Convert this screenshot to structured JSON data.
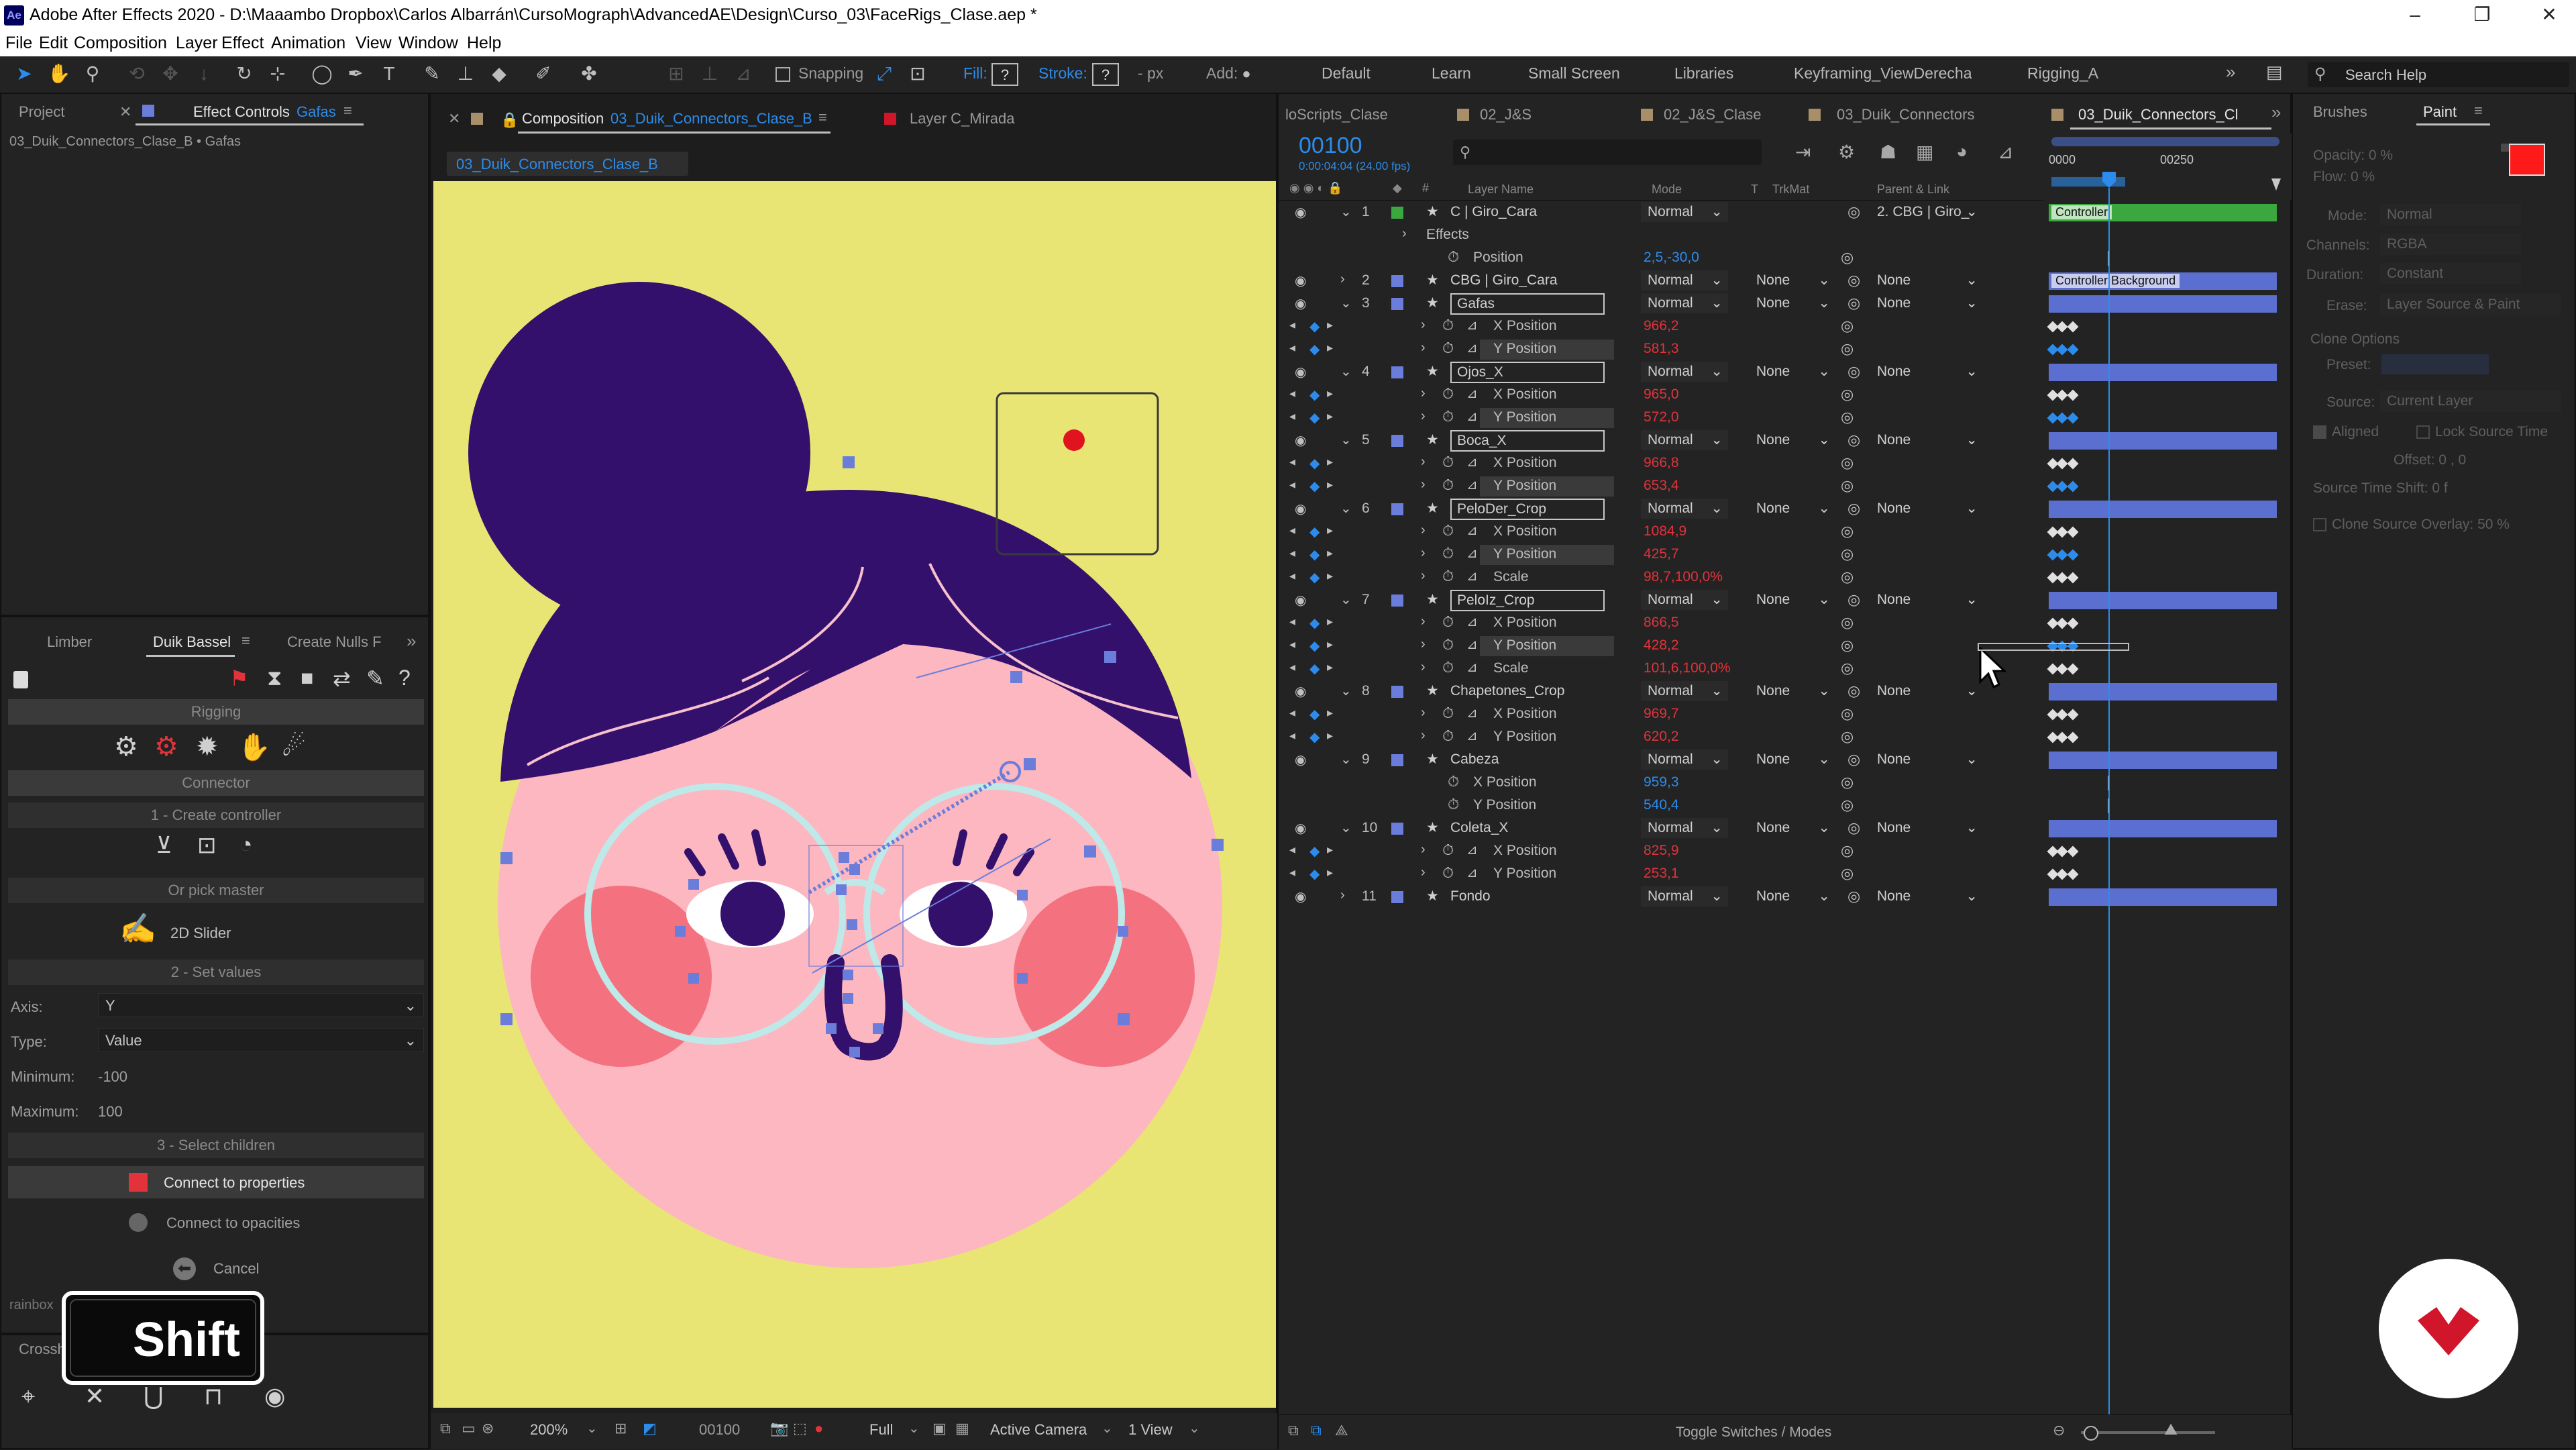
{
  "app": {
    "title": "Adobe After Effects 2020 - D:\\Maaambo Dropbox\\Carlos Albarrán\\CursoMograph\\AdvancedAE\\Design\\Curso_03\\FaceRigs_Clase.aep *",
    "logo": "Ae"
  },
  "menu": [
    "File",
    "Edit",
    "Composition",
    "Layer",
    "Effect",
    "Animation",
    "View",
    "Window",
    "Help"
  ],
  "toolbar": {
    "snapping": "Snapping",
    "fill": "Fill:",
    "fill_value": "?",
    "stroke": "Stroke:",
    "stroke_value": "?",
    "px": "- px",
    "add": "Add:",
    "workspaces": [
      "Default",
      "Learn",
      "Small Screen",
      "Libraries",
      "Keyframing_ViewDerecha",
      "Rigging_A"
    ],
    "search_placeholder": "Search Help"
  },
  "left_panel": {
    "tabs": [
      "Project",
      "Effect Controls",
      "Gafas"
    ],
    "breadcrumb": "03_Duik_Connectors_Clase_B • Gafas"
  },
  "duik": {
    "tabs": [
      "Limber",
      "Duik Bassel",
      "Create Nulls F"
    ],
    "rigging": "Rigging",
    "connector": "Connector",
    "create_controller": "1 - Create controller",
    "or_pick_master": "Or pick master",
    "slider_label": "2D Slider",
    "set_values": "2 - Set values",
    "axis_label": "Axis:",
    "axis_value": "Y",
    "type_label": "Type:",
    "type_value": "Value",
    "min_label": "Minimum:",
    "min_value": "-100",
    "max_label": "Maximum:",
    "max_value": "100",
    "select_children": "3 - Select children",
    "connect_properties": "Connect to properties",
    "connect_opacities": "Connect to opacities",
    "cancel": "Cancel",
    "footer_text": "rainbox",
    "crosshair_tab": "Crossh",
    "shift_key": "Shift"
  },
  "composition": {
    "tab_prefix": "Composition",
    "tab_name": "03_Duik_Connectors_Clase_B",
    "layer_tab": "Layer C_Mirada",
    "breadcrumb": "03_Duik_Connectors_Clase_B",
    "zoom": "200%",
    "timecode": "00100",
    "resolution": "Full",
    "camera": "Active Camera",
    "view": "1 View"
  },
  "timeline": {
    "tabs": [
      "loScripts_Clase",
      "02_J&S",
      "02_J&S_Clase",
      "03_Duik_Connectors",
      "03_Duik_Connectors_Cl"
    ],
    "timecode": "00100",
    "timecode_sub": "0:00:04:04 (24.00 fps)",
    "columns": {
      "layer_name": "Layer Name",
      "mode": "Mode",
      "t": "T",
      "trkmat": "TrkMat",
      "parent": "Parent & Link"
    },
    "ruler": [
      "0000",
      "00250"
    ],
    "bar_labels": {
      "controller": "Controller",
      "controller_bg": "Controller Background"
    },
    "footer": "Toggle Switches / Modes",
    "rows": [
      {
        "type": "layer",
        "num": "1",
        "name": "C | Giro_Cara",
        "mode": "Normal",
        "trk": "",
        "parent": "2. CBG | Giro_",
        "green": true,
        "expanded": true
      },
      {
        "type": "group",
        "name": "Effects"
      },
      {
        "type": "prop",
        "name": "Position",
        "value": "2,5,-30,0",
        "blue": true,
        "static": true
      },
      {
        "type": "layer",
        "num": "2",
        "name": "CBG | Giro_Cara",
        "mode": "Normal",
        "trk": "None",
        "parent": "None"
      },
      {
        "type": "layer",
        "num": "3",
        "name": "Gafas",
        "mode": "Normal",
        "trk": "None",
        "parent": "None",
        "boxed": true,
        "expanded": true
      },
      {
        "type": "prop",
        "name": "X Position",
        "value": "966,2",
        "kf": true
      },
      {
        "type": "prop",
        "name": "Y Position",
        "value": "581,3",
        "kf": true,
        "hl": true
      },
      {
        "type": "layer",
        "num": "4",
        "name": "Ojos_X",
        "mode": "Normal",
        "trk": "None",
        "parent": "None",
        "boxed": true,
        "expanded": true
      },
      {
        "type": "prop",
        "name": "X Position",
        "value": "965,0",
        "kf": true
      },
      {
        "type": "prop",
        "name": "Y Position",
        "value": "572,0",
        "kf": true,
        "hl": true
      },
      {
        "type": "layer",
        "num": "5",
        "name": "Boca_X",
        "mode": "Normal",
        "trk": "None",
        "parent": "None",
        "boxed": true,
        "expanded": true
      },
      {
        "type": "prop",
        "name": "X Position",
        "value": "966,8",
        "kf": true
      },
      {
        "type": "prop",
        "name": "Y Position",
        "value": "653,4",
        "kf": true,
        "hl": true
      },
      {
        "type": "layer",
        "num": "6",
        "name": "PeloDer_Crop",
        "mode": "Normal",
        "trk": "None",
        "parent": "None",
        "boxed": true,
        "expanded": true
      },
      {
        "type": "prop",
        "name": "X Position",
        "value": "1084,9",
        "kf": true
      },
      {
        "type": "prop",
        "name": "Y Position",
        "value": "425,7",
        "kf": true,
        "hl": true
      },
      {
        "type": "prop",
        "name": "Scale",
        "value": "98,7,100,0%",
        "kf": true
      },
      {
        "type": "layer",
        "num": "7",
        "name": "PeloIz_Crop",
        "mode": "Normal",
        "trk": "None",
        "parent": "None",
        "boxed": true,
        "expanded": true
      },
      {
        "type": "prop",
        "name": "X Position",
        "value": "866,5",
        "kf": true
      },
      {
        "type": "prop",
        "name": "Y Position",
        "value": "428,2",
        "kf": true,
        "hl": true
      },
      {
        "type": "prop",
        "name": "Scale",
        "value": "101,6,100,0%",
        "kf": true
      },
      {
        "type": "layer",
        "num": "8",
        "name": "Chapetones_Crop",
        "mode": "Normal",
        "trk": "None",
        "parent": "None",
        "expanded": true
      },
      {
        "type": "prop",
        "name": "X Position",
        "value": "969,7",
        "kf": true
      },
      {
        "type": "prop",
        "name": "Y Position",
        "value": "620,2",
        "kf": true
      },
      {
        "type": "layer",
        "num": "9",
        "name": "Cabeza",
        "mode": "Normal",
        "trk": "None",
        "parent": "None",
        "expanded": true
      },
      {
        "type": "prop",
        "name": "X Position",
        "value": "959,3",
        "blue": true,
        "static": true
      },
      {
        "type": "prop",
        "name": "Y Position",
        "value": "540,4",
        "blue": true,
        "static": true
      },
      {
        "type": "layer",
        "num": "10",
        "name": "Coleta_X",
        "mode": "Normal",
        "trk": "None",
        "parent": "None",
        "expanded": true
      },
      {
        "type": "prop",
        "name": "X Position",
        "value": "825,9",
        "kf": true
      },
      {
        "type": "prop",
        "name": "Y Position",
        "value": "253,1",
        "kf": true
      },
      {
        "type": "layer",
        "num": "11",
        "name": "Fondo",
        "mode": "Normal",
        "trk": "None",
        "parent": "None"
      }
    ]
  },
  "right_panel": {
    "tabs": [
      "Brushes",
      "Paint"
    ],
    "opacity": "Opacity: 0 %",
    "flow": "Flow: 0 %",
    "mode": "Mode:",
    "mode_value": "Normal",
    "channels": "Channels:",
    "channels_value": "RGBA",
    "duration": "Duration:",
    "duration_value": "Constant",
    "erase": "Erase:",
    "erase_value": "Layer Source & Paint",
    "clone_options": "Clone Options",
    "preset": "Preset:",
    "source": "Source:",
    "source_value": "Current Layer",
    "aligned": "Aligned",
    "lock_source": "Lock Source Time",
    "offset": "Offset: 0 , 0",
    "source_shift": "Source Time Shift: 0 f",
    "clone_overlay": "Clone Source Overlay: 50 %",
    "color": "#ff1a1a"
  },
  "colors": {
    "canvas_bg": "#e9e574",
    "hair": "#33106b",
    "face": "#fcb7c0",
    "cheek": "#f4727f",
    "glasses": "#bfe8e8",
    "handle": "#6a7ddb",
    "accent": "#2d8ceb",
    "badge": "#d1152a"
  }
}
